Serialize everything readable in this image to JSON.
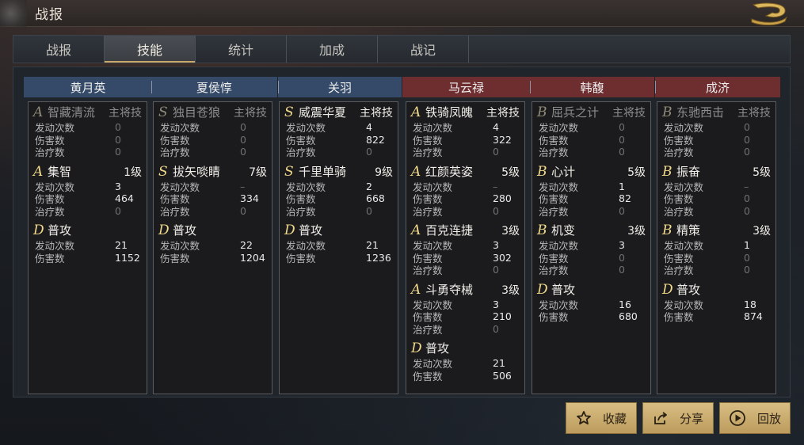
{
  "header": {
    "title": "战报"
  },
  "tabs": [
    "战报",
    "技能",
    "统计",
    "加成",
    "战记"
  ],
  "active_tab": 1,
  "columns": [
    {
      "hero": "黄月英",
      "side": "blue",
      "skills": [
        {
          "grade": "A",
          "name": "智藏清流",
          "tag": "主将技",
          "dim": true,
          "stats": [
            [
              "发动次数",
              "0"
            ],
            [
              "伤害数",
              "0"
            ],
            [
              "治疗数",
              "0"
            ]
          ]
        },
        {
          "grade": "A",
          "name": "集智",
          "tag": "1级",
          "dim": false,
          "stats": [
            [
              "发动次数",
              "3"
            ],
            [
              "伤害数",
              "464"
            ],
            [
              "治疗数",
              "0"
            ]
          ]
        },
        {
          "grade": "D",
          "name": "普攻",
          "tag": "",
          "dim": false,
          "stats": [
            [
              "发动次数",
              "21"
            ],
            [
              "伤害数",
              "1152"
            ]
          ]
        }
      ]
    },
    {
      "hero": "夏侯惇",
      "side": "blue",
      "skills": [
        {
          "grade": "S",
          "name": "独目苍狼",
          "tag": "主将技",
          "dim": true,
          "stats": [
            [
              "发动次数",
              "0"
            ],
            [
              "伤害数",
              "0"
            ],
            [
              "治疗数",
              "0"
            ]
          ]
        },
        {
          "grade": "S",
          "name": "拔矢啖睛",
          "tag": "7级",
          "dim": false,
          "stats": [
            [
              "发动次数",
              "–"
            ],
            [
              "伤害数",
              "334"
            ],
            [
              "治疗数",
              "0"
            ]
          ]
        },
        {
          "grade": "D",
          "name": "普攻",
          "tag": "",
          "dim": false,
          "stats": [
            [
              "发动次数",
              "22"
            ],
            [
              "伤害数",
              "1204"
            ]
          ]
        }
      ]
    },
    {
      "hero": "关羽",
      "side": "blue",
      "skills": [
        {
          "grade": "S",
          "name": "威震华夏",
          "tag": "主将技",
          "dim": false,
          "stats": [
            [
              "发动次数",
              "4"
            ],
            [
              "伤害数",
              "822"
            ],
            [
              "治疗数",
              "0"
            ]
          ]
        },
        {
          "grade": "S",
          "name": "千里单骑",
          "tag": "9级",
          "dim": false,
          "stats": [
            [
              "发动次数",
              "2"
            ],
            [
              "伤害数",
              "668"
            ],
            [
              "治疗数",
              "0"
            ]
          ]
        },
        {
          "grade": "D",
          "name": "普攻",
          "tag": "",
          "dim": false,
          "stats": [
            [
              "发动次数",
              "21"
            ],
            [
              "伤害数",
              "1236"
            ]
          ]
        }
      ]
    },
    {
      "hero": "马云禄",
      "side": "red",
      "skills": [
        {
          "grade": "A",
          "name": "铁骑凤魄",
          "tag": "主将技",
          "dim": false,
          "stats": [
            [
              "发动次数",
              "4"
            ],
            [
              "伤害数",
              "322"
            ],
            [
              "治疗数",
              "0"
            ]
          ]
        },
        {
          "grade": "A",
          "name": "红颜英姿",
          "tag": "5级",
          "dim": false,
          "stats": [
            [
              "发动次数",
              "–"
            ],
            [
              "伤害数",
              "280"
            ],
            [
              "治疗数",
              "0"
            ]
          ]
        },
        {
          "grade": "A",
          "name": "百克连捷",
          "tag": "3级",
          "dim": false,
          "stats": [
            [
              "发动次数",
              "3"
            ],
            [
              "伤害数",
              "302"
            ],
            [
              "治疗数",
              "0"
            ]
          ]
        },
        {
          "grade": "A",
          "name": "斗勇夺械",
          "tag": "3级",
          "dim": false,
          "stats": [
            [
              "发动次数",
              "3"
            ],
            [
              "伤害数",
              "210"
            ],
            [
              "治疗数",
              "0"
            ]
          ]
        },
        {
          "grade": "D",
          "name": "普攻",
          "tag": "",
          "dim": false,
          "stats": [
            [
              "发动次数",
              "21"
            ],
            [
              "伤害数",
              "506"
            ]
          ]
        }
      ]
    },
    {
      "hero": "韩馥",
      "side": "red",
      "skills": [
        {
          "grade": "B",
          "name": "屈兵之计",
          "tag": "主将技",
          "dim": true,
          "stats": [
            [
              "发动次数",
              "0"
            ],
            [
              "伤害数",
              "0"
            ],
            [
              "治疗数",
              "0"
            ]
          ]
        },
        {
          "grade": "B",
          "name": "心计",
          "tag": "5级",
          "dim": false,
          "stats": [
            [
              "发动次数",
              "1"
            ],
            [
              "伤害数",
              "82"
            ],
            [
              "治疗数",
              "0"
            ]
          ]
        },
        {
          "grade": "B",
          "name": "机变",
          "tag": "3级",
          "dim": false,
          "stats": [
            [
              "发动次数",
              "3"
            ],
            [
              "伤害数",
              "0"
            ],
            [
              "治疗数",
              "0"
            ]
          ]
        },
        {
          "grade": "D",
          "name": "普攻",
          "tag": "",
          "dim": false,
          "stats": [
            [
              "发动次数",
              "16"
            ],
            [
              "伤害数",
              "680"
            ]
          ]
        }
      ]
    },
    {
      "hero": "成济",
      "side": "red",
      "skills": [
        {
          "grade": "B",
          "name": "东驰西击",
          "tag": "主将技",
          "dim": true,
          "stats": [
            [
              "发动次数",
              "0"
            ],
            [
              "伤害数",
              "0"
            ],
            [
              "治疗数",
              "0"
            ]
          ]
        },
        {
          "grade": "B",
          "name": "振奋",
          "tag": "5级",
          "dim": false,
          "stats": [
            [
              "发动次数",
              "–"
            ],
            [
              "伤害数",
              "0"
            ],
            [
              "治疗数",
              "0"
            ]
          ]
        },
        {
          "grade": "B",
          "name": "精策",
          "tag": "3级",
          "dim": false,
          "stats": [
            [
              "发动次数",
              "1"
            ],
            [
              "伤害数",
              "0"
            ],
            [
              "治疗数",
              "0"
            ]
          ]
        },
        {
          "grade": "D",
          "name": "普攻",
          "tag": "",
          "dim": false,
          "stats": [
            [
              "发动次数",
              "18"
            ],
            [
              "伤害数",
              "874"
            ]
          ]
        }
      ]
    }
  ],
  "buttons": {
    "favorite": {
      "label": "收藏",
      "icon": "star-icon"
    },
    "share": {
      "label": "分享",
      "icon": "share-icon"
    },
    "replay": {
      "label": "回放",
      "icon": "play-icon"
    }
  },
  "colors": {
    "accent_gold": "#d8bd82",
    "team_blue": "#344a68",
    "team_red": "#6e2e30",
    "grade_gold": "#f0d98a"
  }
}
